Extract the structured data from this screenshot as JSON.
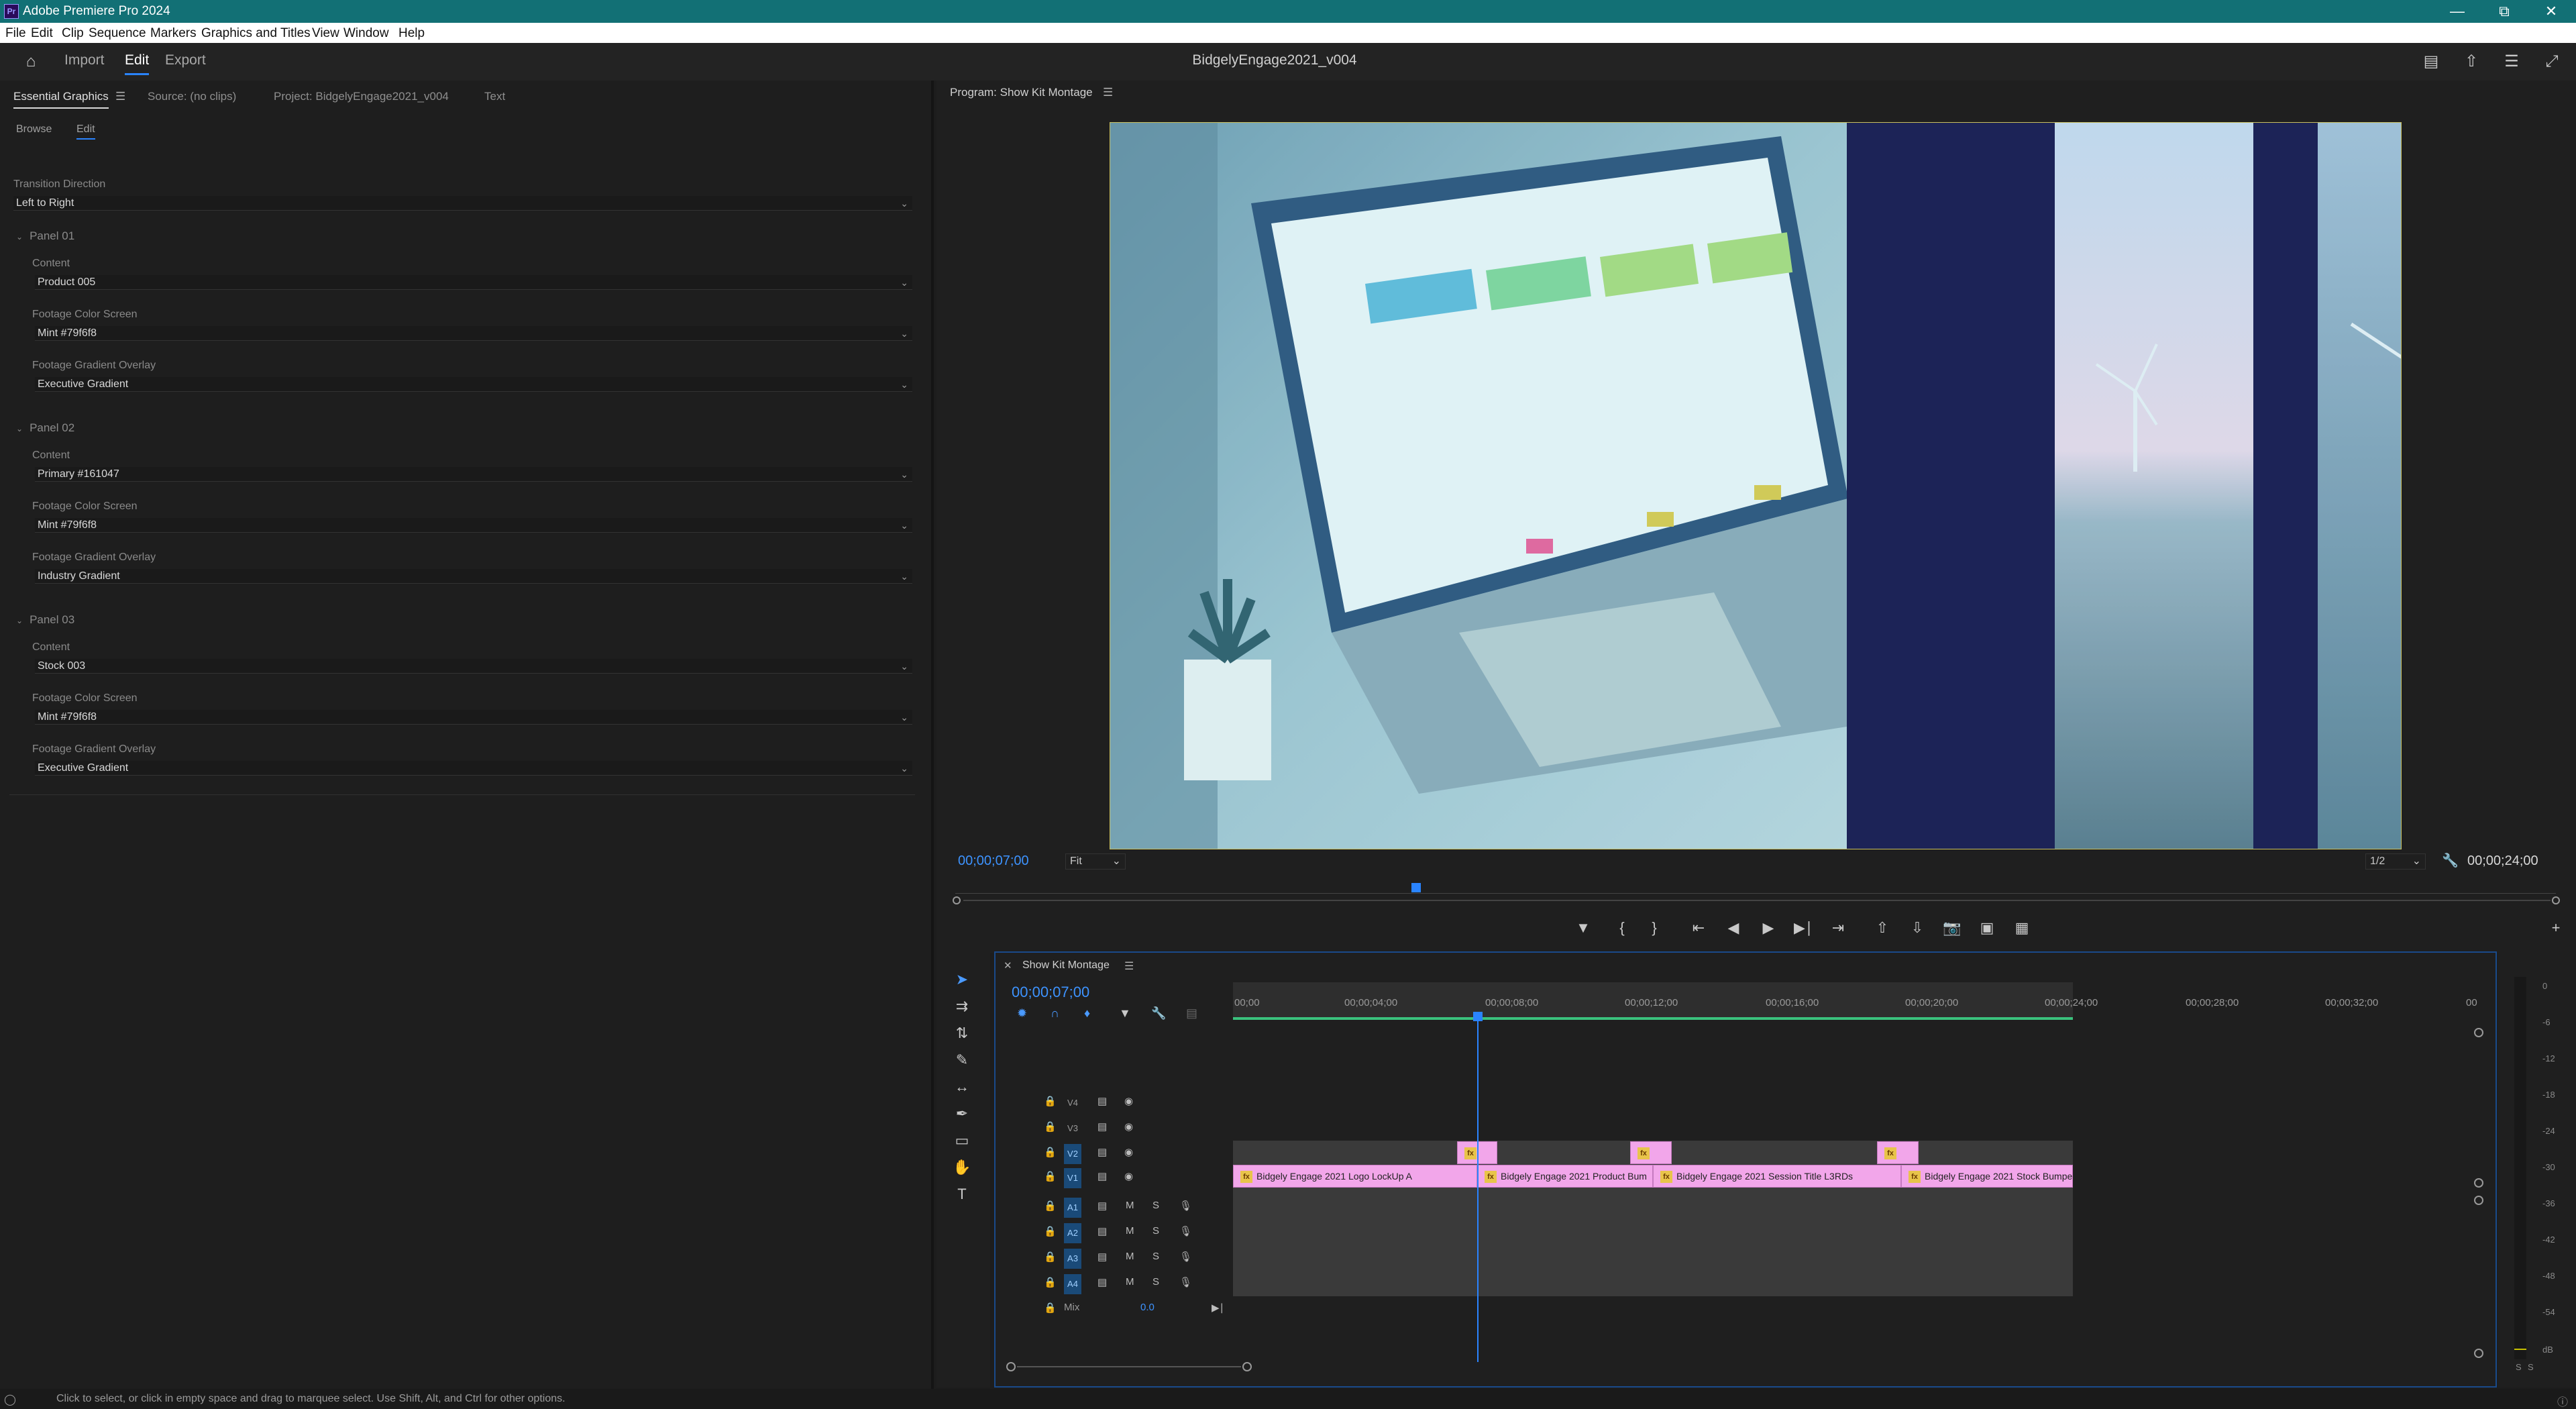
{
  "window": {
    "title": "Adobe Premiere Pro 2024",
    "app_icon": "Pr",
    "controls": [
      "minimize-icon",
      "restore-icon",
      "close-icon"
    ]
  },
  "menubar": {
    "items": [
      "File",
      "Edit",
      "Clip",
      "Sequence",
      "Markers",
      "Graphics and Titles",
      "View",
      "Window",
      "Help"
    ]
  },
  "workspace": {
    "home_icon": "home-icon",
    "tabs": [
      "Import",
      "Edit",
      "Export"
    ],
    "active_tab": "Edit",
    "document_title": "BidgelyEngage2021_v004",
    "right_icons": [
      "captions-icon",
      "share-icon",
      "workspaces-icon",
      "fullscreen-icon"
    ]
  },
  "left_panel": {
    "tabs": [
      "Essential Graphics",
      "Source: (no clips)",
      "Project: BidgelyEngage2021_v004",
      "Text"
    ],
    "active_tab": "Essential Graphics",
    "subtabs": [
      "Browse",
      "Edit"
    ],
    "active_subtab": "Edit",
    "transition": {
      "label": "Transition Direction",
      "value": "Left to Right"
    },
    "panels": [
      {
        "name": "Panel 01",
        "fields": [
          {
            "label": "Content",
            "value": "Product 005"
          },
          {
            "label": "Footage Color Screen",
            "value": "Mint #79f6f8"
          },
          {
            "label": "Footage Gradient Overlay",
            "value": "Executive Gradient"
          }
        ]
      },
      {
        "name": "Panel 02",
        "fields": [
          {
            "label": "Content",
            "value": "Primary #161047"
          },
          {
            "label": "Footage Color Screen",
            "value": "Mint #79f6f8"
          },
          {
            "label": "Footage Gradient Overlay",
            "value": "Industry Gradient"
          }
        ]
      },
      {
        "name": "Panel 03",
        "fields": [
          {
            "label": "Content",
            "value": "Stock 003"
          },
          {
            "label": "Footage Color Screen",
            "value": "Mint #79f6f8"
          },
          {
            "label": "Footage Gradient Overlay",
            "value": "Executive Gradient"
          }
        ]
      }
    ]
  },
  "program_monitor": {
    "label": "Program: Show Kit Montage",
    "timecode": "00;00;07;00",
    "fit": "Fit",
    "resolution": "1/2",
    "duration": "00;00;24;00",
    "controls": [
      "marker-icon",
      "mark-in-icon",
      "mark-out-icon",
      "go-to-in-icon",
      "step-back-icon",
      "play-icon",
      "step-forward-icon",
      "go-to-out-icon",
      "insert-icon",
      "overwrite-icon",
      "export-frame-icon",
      "compare-icon",
      "vr-icon"
    ],
    "add_icon": "plus-icon"
  },
  "timeline": {
    "sequence_name": "Show Kit Montage",
    "timecode": "00;00;07;00",
    "ruler": [
      "00;00",
      "00;00;04;00",
      "00;00;08;00",
      "00;00;12;00",
      "00;00;16;00",
      "00;00;20;00",
      "00;00;24;00",
      "00;00;28;00",
      "00;00;32;00",
      "00"
    ],
    "video_tracks": [
      "V4",
      "V3",
      "V2",
      "V1"
    ],
    "audio_tracks": [
      "A1",
      "A2",
      "A3",
      "A4"
    ],
    "mix_label": "Mix",
    "mix_value": "0.0",
    "audio_buttons": [
      "M",
      "S"
    ],
    "clips_v1": [
      "Bidgely Engage 2021 Logo LockUp A",
      "Bidgely Engage 2021 Product Bum",
      "Bidgely Engage 2021 Session Title L3RDs",
      "Bidgely Engage 2021 Stock Bumpe"
    ],
    "fx_badge": "fx",
    "clip_color": "#f2a6ea",
    "meter_scale": [
      "0",
      "-6",
      "-12",
      "-18",
      "-24",
      "-30",
      "-36",
      "-42",
      "-48",
      "-54",
      "dB"
    ],
    "meter_channels": [
      "S",
      "S"
    ]
  },
  "status_bar": {
    "text": "Click to select, or click in empty space and drag to marquee select. Use Shift, Alt, and Ctrl for other options."
  },
  "colors": {
    "accent": "#2a84ff",
    "titlebar": "#127075",
    "timecode": "#3d93ff"
  }
}
